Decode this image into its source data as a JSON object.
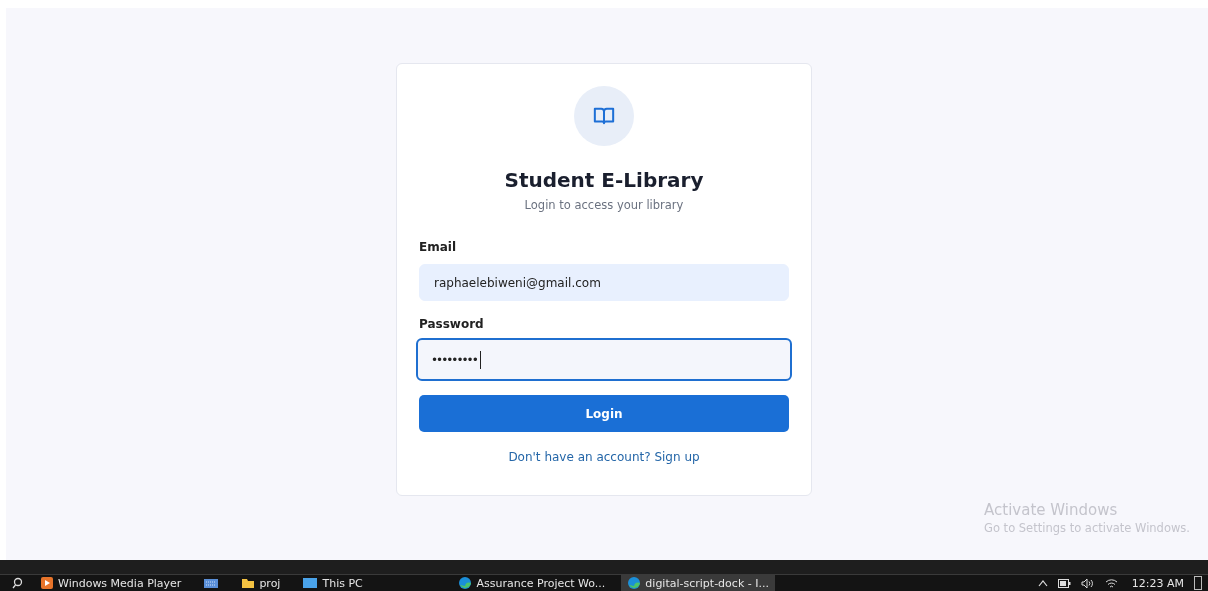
{
  "login_card": {
    "title": "Student E-Library",
    "subtitle": "Login to access your library",
    "fields": [
      {
        "label": "Email",
        "value": "raphaelebiweni@gmail.com",
        "focused": false
      },
      {
        "label": "Password",
        "value": "•••••••••",
        "focused": true
      }
    ],
    "button": "Login",
    "signup_link": "Don't have an account? Sign up"
  },
  "activation_notice": {
    "title": "Activate Windows",
    "message": "Go to Settings to activate Windows."
  },
  "taskbar": {
    "items": [
      {
        "label": "Windows Media Player",
        "selected": false
      },
      {
        "selected": false
      },
      {
        "label": "proj",
        "selected": false
      },
      {
        "label": "This PC",
        "selected": false
      },
      {
        "label": "Assurance Project Wo...",
        "selected": false
      },
      {
        "label": "digital-script-dock - I...",
        "selected": true
      }
    ],
    "clock": "12:23 AM"
  }
}
